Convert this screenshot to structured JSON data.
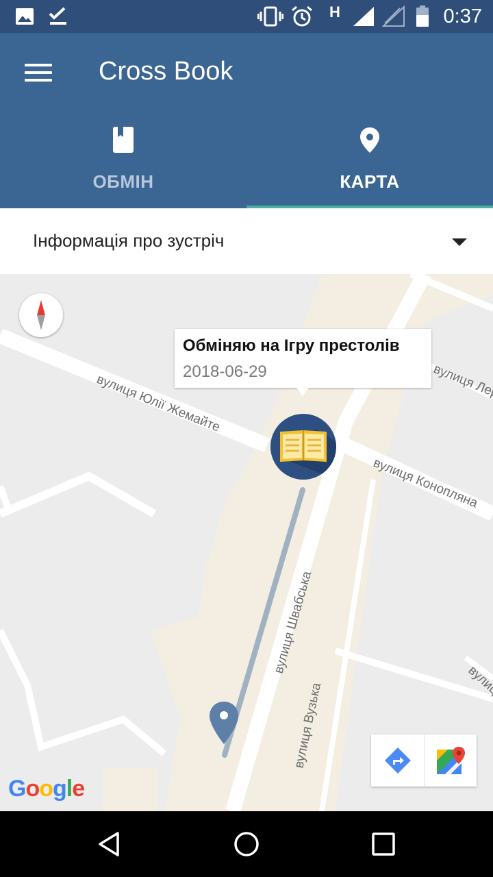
{
  "status_bar": {
    "time": "0:37",
    "network_label": "H",
    "icons": [
      "image-icon",
      "checkmark-icon",
      "vibrate-icon",
      "alarm-icon",
      "signal-icon",
      "signal-empty-icon",
      "battery-icon"
    ]
  },
  "app_bar": {
    "title": "Cross Book",
    "tabs": [
      {
        "label": "ОБМІН",
        "icon": "book-icon",
        "selected": false
      },
      {
        "label": "КАРТА",
        "icon": "location-pin-icon",
        "selected": true
      }
    ]
  },
  "meeting_info": {
    "label": "Інформація про зустріч"
  },
  "map": {
    "info_window": {
      "title": "Обміняю на Ігру престолів",
      "date": "2018-06-29"
    },
    "streets": [
      "вулиця Юлії Жемайте",
      "вулиця Лерм",
      "вулиця Коноплянa",
      "вулиця Швабська",
      "вулиця Вузька",
      "вулиц"
    ],
    "logo": "Google",
    "buttons": [
      "directions-icon",
      "google-maps-icon"
    ]
  },
  "nav_bar": {
    "buttons": [
      "back-icon",
      "home-icon",
      "recents-icon"
    ]
  },
  "colors": {
    "status_bar": "#2f4f7a",
    "app_bar": "#3b6592",
    "tab_indicator": "#4caf9f",
    "marker": "#2d4f82"
  }
}
